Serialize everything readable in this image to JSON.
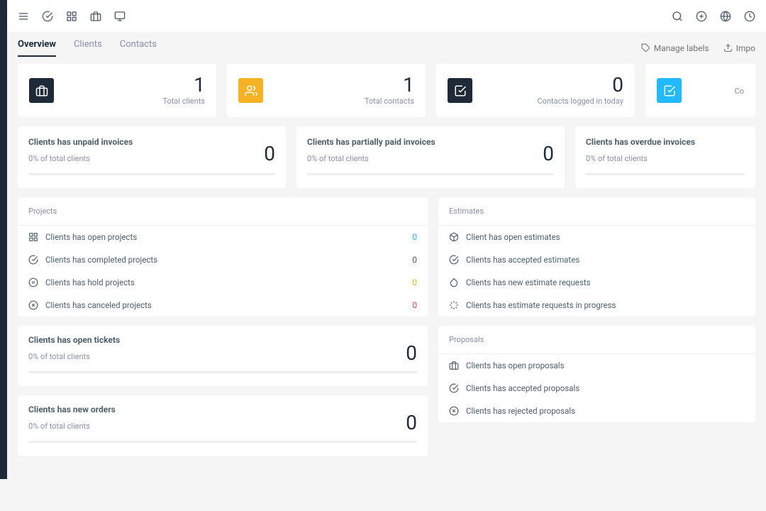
{
  "tabs": {
    "overview": "Overview",
    "clients": "Clients",
    "contacts": "Contacts"
  },
  "actions": {
    "manage_labels": "Manage labels",
    "import": "Impo"
  },
  "stats": [
    {
      "value": "1",
      "label": "Total clients",
      "icon": "briefcase",
      "color": "black"
    },
    {
      "value": "1",
      "label": "Total contacts",
      "icon": "users",
      "color": "orange"
    },
    {
      "value": "0",
      "label": "Contacts logged in today",
      "icon": "check-square",
      "color": "black"
    },
    {
      "value": "",
      "label": "Co",
      "icon": "check-square",
      "color": "blue"
    }
  ],
  "invoices": [
    {
      "title": "Clients has unpaid invoices",
      "sub": "0% of total clients",
      "value": "0"
    },
    {
      "title": "Clients has partially paid invoices",
      "sub": "0% of total clients",
      "value": "0"
    },
    {
      "title": "Clients has overdue invoices",
      "sub": "0% of total clients",
      "value": ""
    }
  ],
  "projects": {
    "title": "Projects",
    "rows": [
      {
        "icon": "grid",
        "label": "Clients has open projects",
        "value": "0",
        "vclass": "v-blue"
      },
      {
        "icon": "check-circle",
        "label": "Clients has completed projects",
        "value": "0",
        "vclass": "v-gray"
      },
      {
        "icon": "pause",
        "label": "Clients has hold projects",
        "value": "0",
        "vclass": "v-orange"
      },
      {
        "icon": "x-circle",
        "label": "Clients has canceled projects",
        "value": "0",
        "vclass": "v-red"
      }
    ]
  },
  "estimates": {
    "title": "Estimates",
    "rows": [
      {
        "icon": "box",
        "label": "Client has open estimates"
      },
      {
        "icon": "check-circle",
        "label": "Clients has accepted estimates"
      },
      {
        "icon": "droplet",
        "label": "Clients has new estimate requests"
      },
      {
        "icon": "loader",
        "label": "Clients has estimate requests in progress"
      }
    ]
  },
  "open_tickets": {
    "title": "Clients has open tickets",
    "sub": "0% of total clients",
    "value": "0"
  },
  "new_orders": {
    "title": "Clients has new orders",
    "sub": "0% of total clients",
    "value": "0"
  },
  "proposals": {
    "title": "Proposals",
    "rows": [
      {
        "icon": "briefcase",
        "label": "Clients has open proposals"
      },
      {
        "icon": "check-circle",
        "label": "Clients has accepted proposals"
      },
      {
        "icon": "x-circle",
        "label": "Clients has rejected proposals"
      }
    ]
  }
}
